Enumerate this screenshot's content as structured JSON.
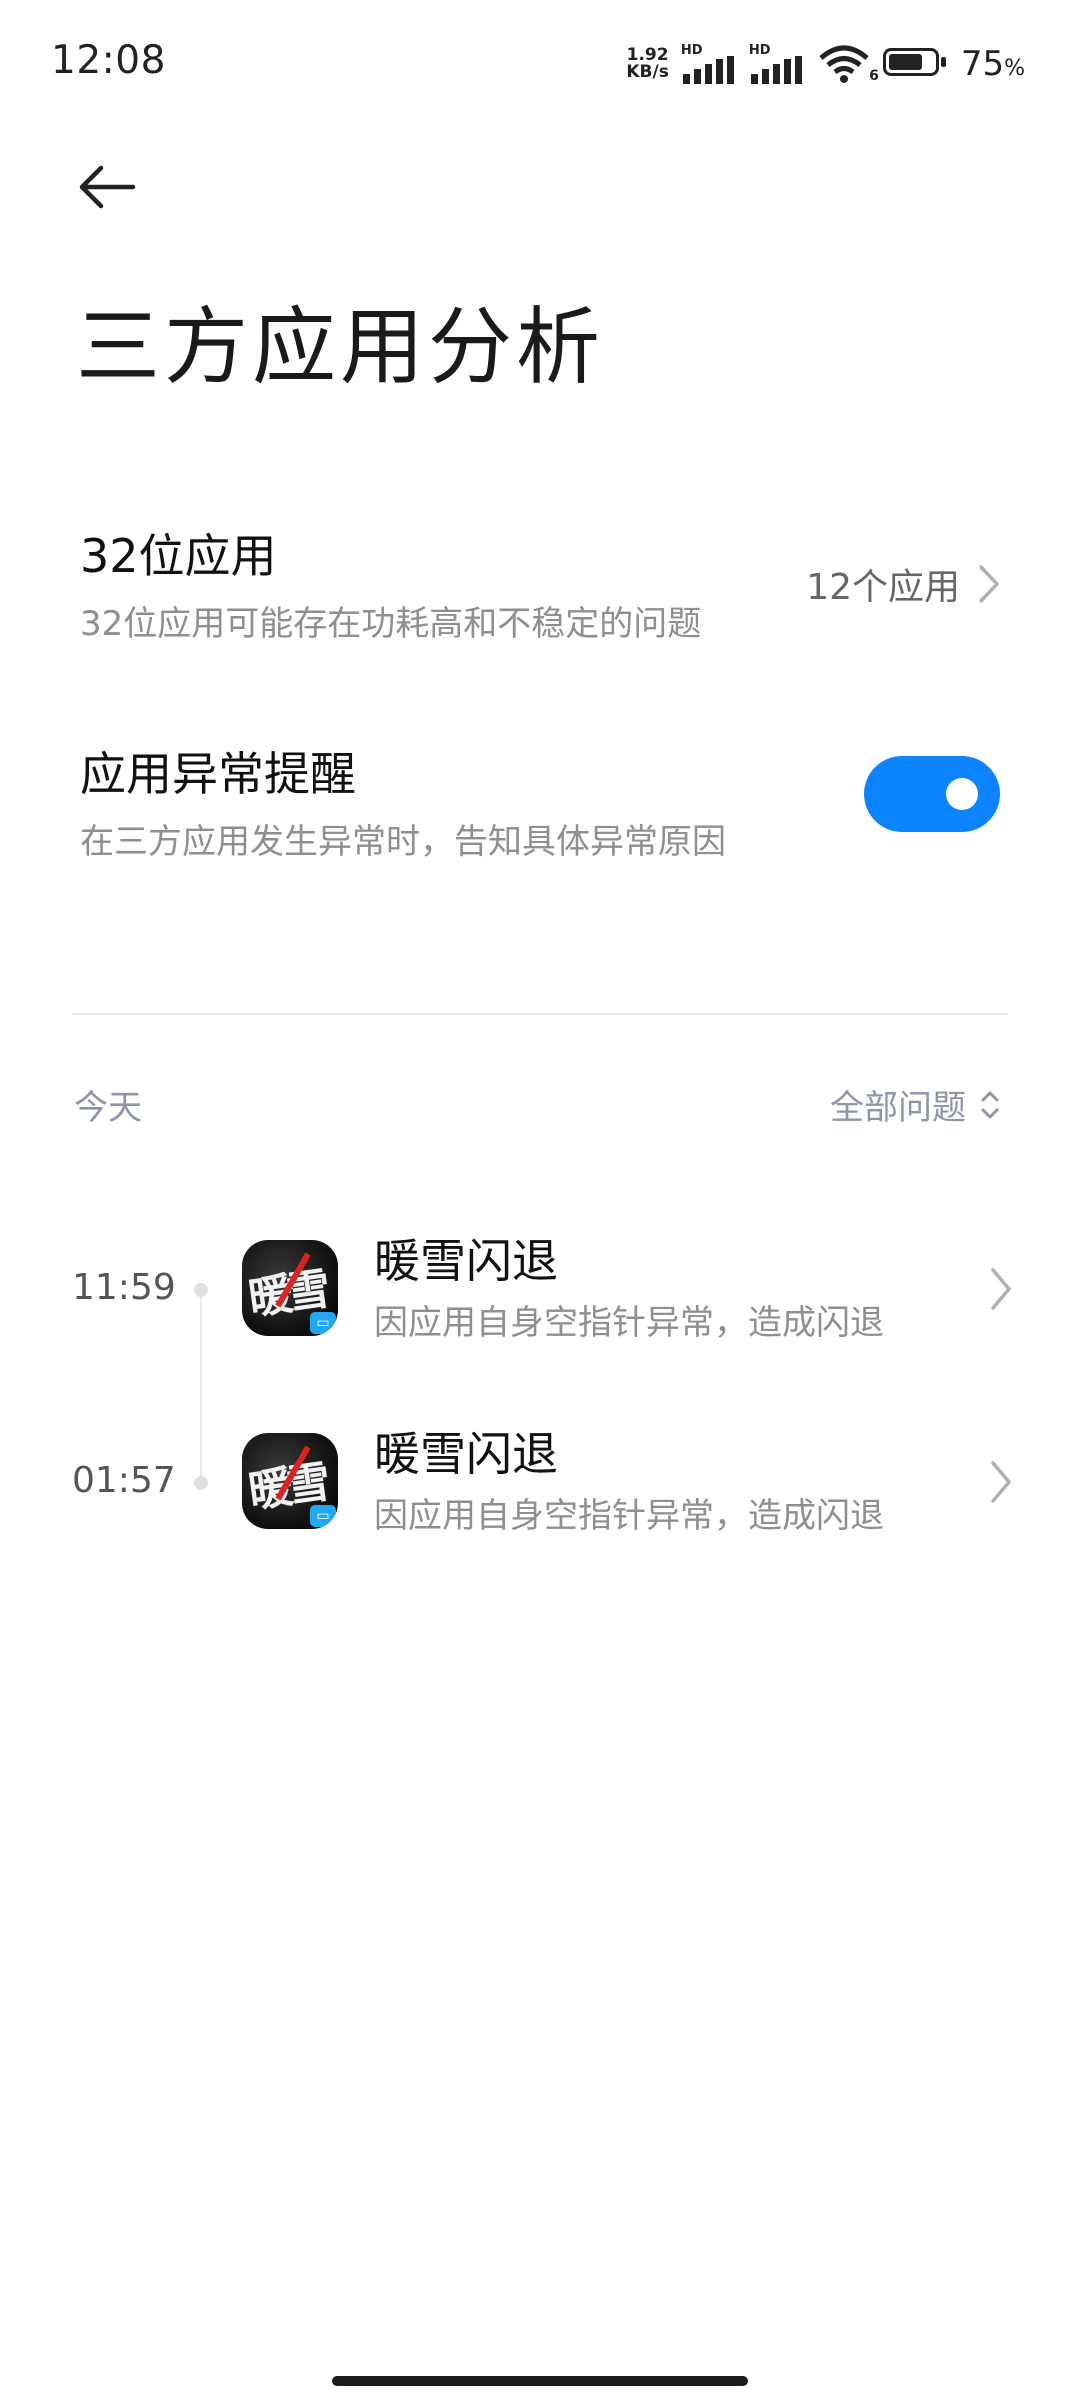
{
  "status_bar": {
    "time": "12:08",
    "net_speed_value": "1.92",
    "net_speed_unit": "KB/s",
    "hd1": "HD",
    "hd2": "HD",
    "wifi_badge": "6",
    "battery_percent": "75",
    "battery_unit": "%",
    "battery_level": 0.75
  },
  "header": {
    "back_icon": "arrow-left-icon",
    "title": "三方应用分析"
  },
  "settings": {
    "apps32": {
      "title": "32位应用",
      "subtitle": "32位应用可能存在功耗高和不稳定的问题",
      "value": "12个应用"
    },
    "alert": {
      "title": "应用异常提醒",
      "subtitle": "在三方应用发生异常时，告知具体异常原因",
      "enabled": true
    }
  },
  "section": {
    "date": "今天",
    "filter_label": "全部问题"
  },
  "events": [
    {
      "time": "11:59",
      "title": "暖雪闪退",
      "desc": "因应用自身空指针异常，造成闪退"
    },
    {
      "time": "01:57",
      "title": "暖雪闪退",
      "desc": "因应用自身空指针异常，造成闪退"
    }
  ],
  "colors": {
    "accent": "#0d84ff",
    "secondary_text": "#8e8e93",
    "section_text": "#8c95ab"
  }
}
